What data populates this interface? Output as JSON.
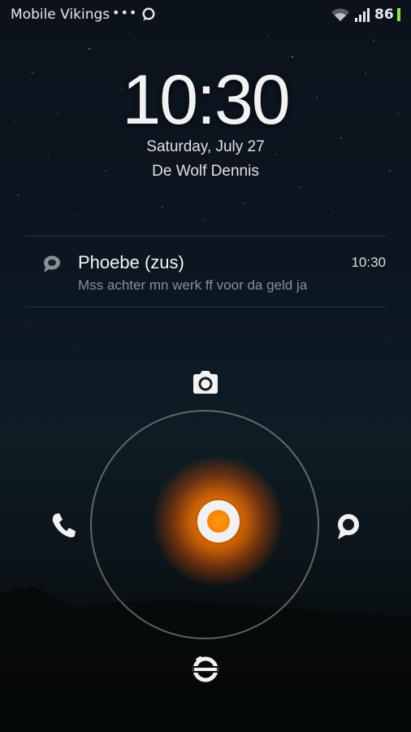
{
  "status_bar": {
    "carrier": "Mobile Vikings",
    "overflow_dots": "•••",
    "battery_level": "86",
    "icons": [
      "message-icon",
      "wifi-icon",
      "signal-icon",
      "battery-icon"
    ],
    "battery_color": "#8de43c"
  },
  "lockscreen": {
    "time": "10:30",
    "date": "Saturday, July 27",
    "owner": "De Wolf Dennis"
  },
  "notification": {
    "icon": "message-icon",
    "title": "Phoebe (zus)",
    "time": "10:30",
    "body": "Mss achter mn werk ff voor da geld ja"
  },
  "unlock_ring": {
    "accent": "#ff8a00",
    "targets": [
      "camera-icon",
      "phone-icon",
      "message-icon",
      "unlock-icon"
    ]
  }
}
